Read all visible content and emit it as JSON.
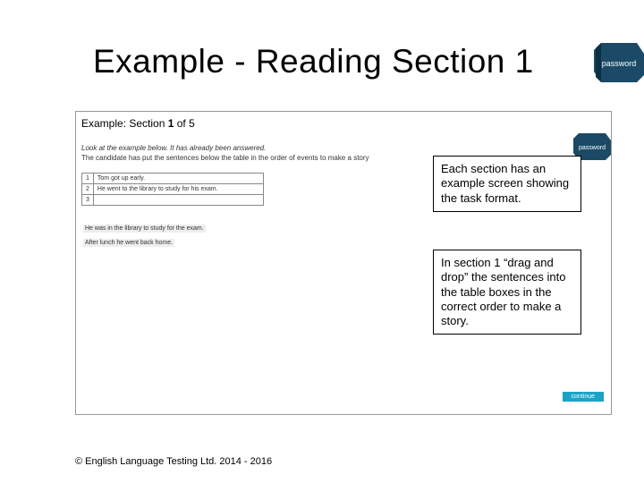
{
  "title": "Example - Reading Section 1",
  "logo_text": "password",
  "shot": {
    "header_prefix": "Example: Section ",
    "header_bold": "1",
    "header_suffix": " of 5",
    "instr1": "Look at the example below. It has already been answered.",
    "instr2": "The candidate has put the sentences below the table in the order of events to make a story",
    "rows": [
      {
        "n": "1",
        "text": "Tom got up early."
      },
      {
        "n": "2",
        "text": "He went to the library to study for his exam."
      },
      {
        "n": "3",
        "text": ""
      }
    ],
    "drag1": "He was in the library to study for the exam.",
    "drag2": "After lunch he went back home.",
    "continue_label": "continue"
  },
  "callouts": {
    "c1": "Each section has an example screen showing the task format.",
    "c2": "In section 1 “drag and drop” the sentences into the table boxes in the correct order to make a story."
  },
  "copyright": "© English Language Testing Ltd. 2014 - 2016"
}
